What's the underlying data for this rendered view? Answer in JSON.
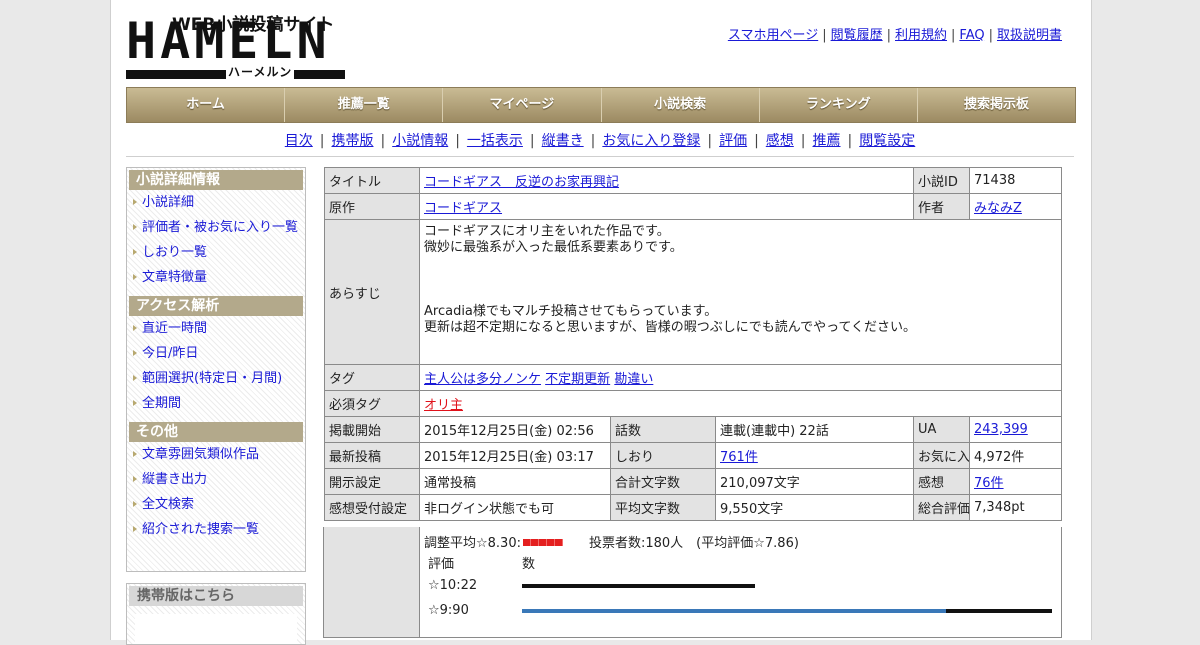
{
  "header": {
    "logo_web": "WEB小説投稿サイト",
    "logo_main": "HAMELN",
    "logo_kana": "ハーメルン",
    "top_links": [
      "スマホ用ページ",
      "閲覧履歴",
      "利用規約",
      "FAQ",
      "取扱説明書"
    ]
  },
  "nav": [
    "ホーム",
    "推薦一覧",
    "マイページ",
    "小説検索",
    "ランキング",
    "捜索掲示板"
  ],
  "subnav": [
    "目次",
    "携帯版",
    "小説情報",
    "一括表示",
    "縦書き",
    "お気に入り登録",
    "評価",
    "感想",
    "推薦",
    "閲覧設定"
  ],
  "sidebar": {
    "sections": [
      {
        "title": "小説詳細情報",
        "items": [
          "小説詳細",
          "評価者・被お気に入り一覧",
          "しおり一覧",
          "文章特徴量"
        ]
      },
      {
        "title": "アクセス解析",
        "items": [
          "直近一時間",
          "今日/昨日",
          "範囲選択(特定日・月間)",
          "全期間"
        ]
      },
      {
        "title": "その他",
        "items": [
          "文章雰囲気類似作品",
          "縦書き出力",
          "全文検索",
          "紹介された捜索一覧"
        ]
      }
    ],
    "mobile_title": "携帯版はこちら"
  },
  "info": {
    "title_label": "タイトル",
    "title": "コードギアス　反逆のお家再興記",
    "id_label": "小説ID",
    "id": "71438",
    "original_label": "原作",
    "original": "コードギアス",
    "author_label": "作者",
    "author": "みなみZ",
    "summary_label": "あらすじ",
    "summary_lines": [
      "コードギアスにオリ主をいれた作品です。",
      "微妙に最強系が入った最低系要素ありです。",
      "",
      "",
      "Arcadia様でもマルチ投稿させてもらっています。",
      "更新は超不定期になると思いますが、皆様の暇つぶしにでも読んでやってください。"
    ],
    "tags_label": "タグ",
    "tags": [
      "主人公は多分ノンケ",
      "不定期更新",
      "勘違い"
    ],
    "must_tags_label": "必須タグ",
    "must_tags": [
      "オリ主"
    ],
    "rows": [
      [
        "掲載開始",
        "2015年12月25日(金) 02:56",
        "話数",
        "連載(連載中) 22話",
        "UA",
        "243,399"
      ],
      [
        "最新投稿",
        "2015年12月25日(金) 03:17",
        "しおり",
        "761件",
        "お気に入り",
        "4,972件"
      ],
      [
        "開示設定",
        "通常投稿",
        "合計文字数",
        "210,097文字",
        "感想",
        "76件"
      ],
      [
        "感想受付設定",
        "非ログイン状態でも可",
        "平均文字数",
        "9,550文字",
        "総合評価",
        "7,348pt"
      ]
    ]
  },
  "rating": {
    "avg_text": "調整平均☆8.30:",
    "votes_text": "投票者数:180人　(平均評価☆7.86)",
    "header_eval": "評価",
    "header_count": "数",
    "rows": [
      {
        "label": "☆10:22",
        "fraction": 0.54
      },
      {
        "label": "☆9:90",
        "fraction": 1.0
      }
    ]
  }
}
